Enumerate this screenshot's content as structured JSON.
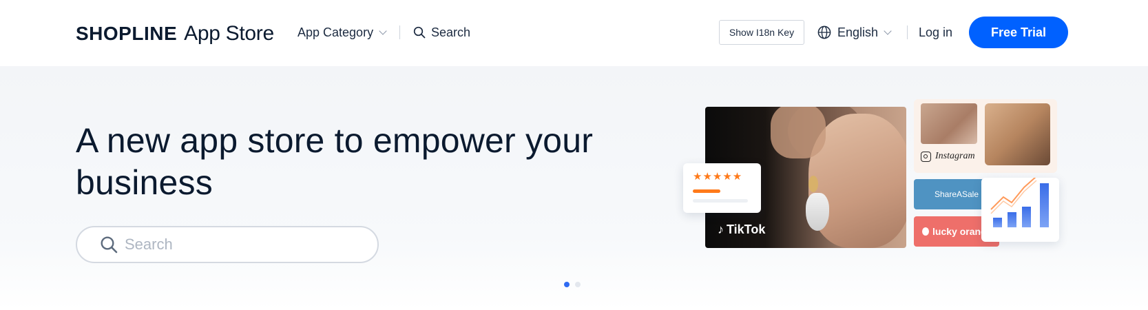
{
  "header": {
    "logo_brand": "SHOPLINE",
    "logo_store": "App Store",
    "nav_category_label": "App Category",
    "nav_search_label": "Search",
    "i18n_button_label": "Show I18n Key",
    "language_label": "English",
    "login_label": "Log in",
    "free_trial_label": "Free Trial",
    "accent_color": "#0061ff"
  },
  "hero": {
    "title": "A new app store to empower your business",
    "search_placeholder": "Search",
    "carousel": {
      "total": 2,
      "active": 1
    },
    "illustration": {
      "tiktok_label": "TikTok",
      "rating_stars": 5,
      "instagram_label": "Instagram",
      "shareasale_label": "ShareASale",
      "lucky_orange_label": "lucky orange"
    }
  },
  "icons": {
    "nav_search": "search-icon",
    "language": "globe-icon",
    "dropdown": "chevron-down-icon",
    "hero_search": "search-icon"
  }
}
